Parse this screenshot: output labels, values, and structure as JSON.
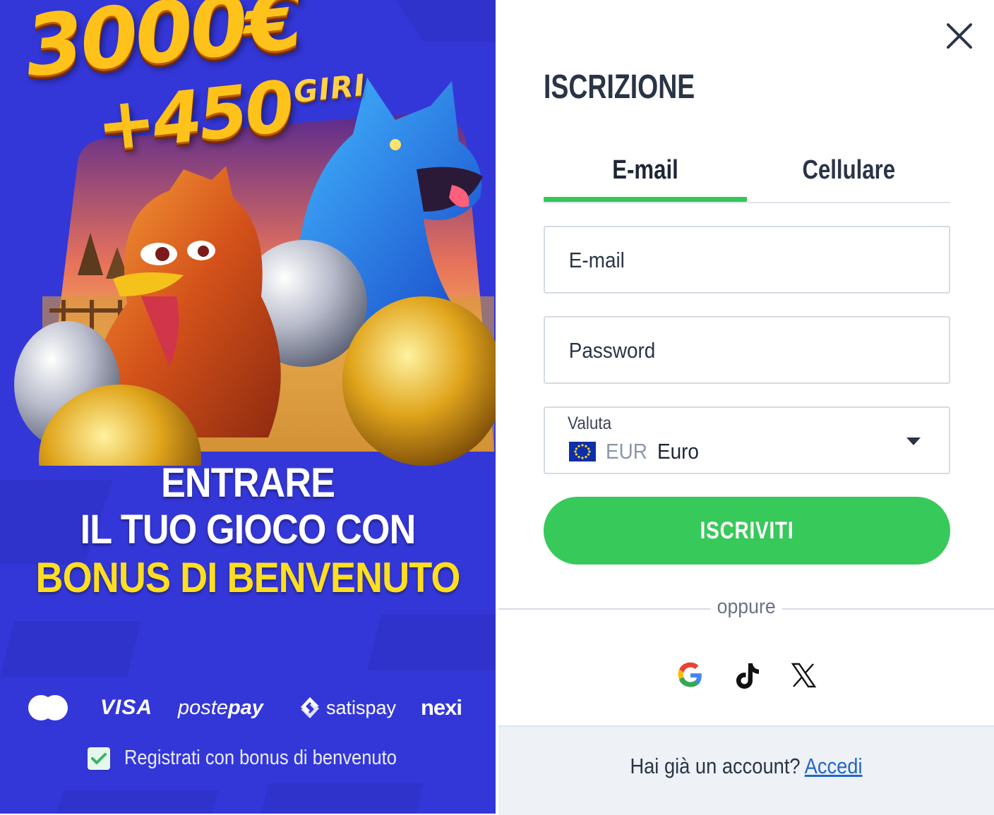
{
  "promo": {
    "amount": "3000€",
    "spins_number": "+450",
    "spins_word": "GIRI",
    "headline_line1": "ENTRARE",
    "headline_line2": "IL TUO GIOCO CON",
    "headline_line3": "BONUS DI BENVENUTO",
    "payments": {
      "visa": "VISA",
      "postepay_a": "poste",
      "postepay_b": "pay",
      "satispay": "satispay",
      "nexi": "nexi"
    },
    "bonus_checkbox": {
      "label": "Registrati con bonus di benvenuto",
      "checked": true
    }
  },
  "form": {
    "title": "ISCRIZIONE",
    "tabs": [
      {
        "label": "E-mail",
        "active": true
      },
      {
        "label": "Cellulare",
        "active": false
      }
    ],
    "email": {
      "placeholder": "E-mail",
      "value": ""
    },
    "password": {
      "placeholder": "Password",
      "value": ""
    },
    "currency": {
      "label": "Valuta",
      "code": "EUR",
      "name": "Euro"
    },
    "submit_label": "ISCRIVITI",
    "divider_text": "oppure",
    "social": [
      "google-icon",
      "tiktok-icon",
      "x-icon"
    ],
    "footer_question": "Hai già un account?",
    "footer_link": "Accedi"
  },
  "colors": {
    "promo_bg": "#3336d6",
    "accent_green": "#37c95a",
    "headline_yellow": "#ffde1f",
    "link_blue": "#2266cc",
    "text_dark": "#2b3447"
  }
}
